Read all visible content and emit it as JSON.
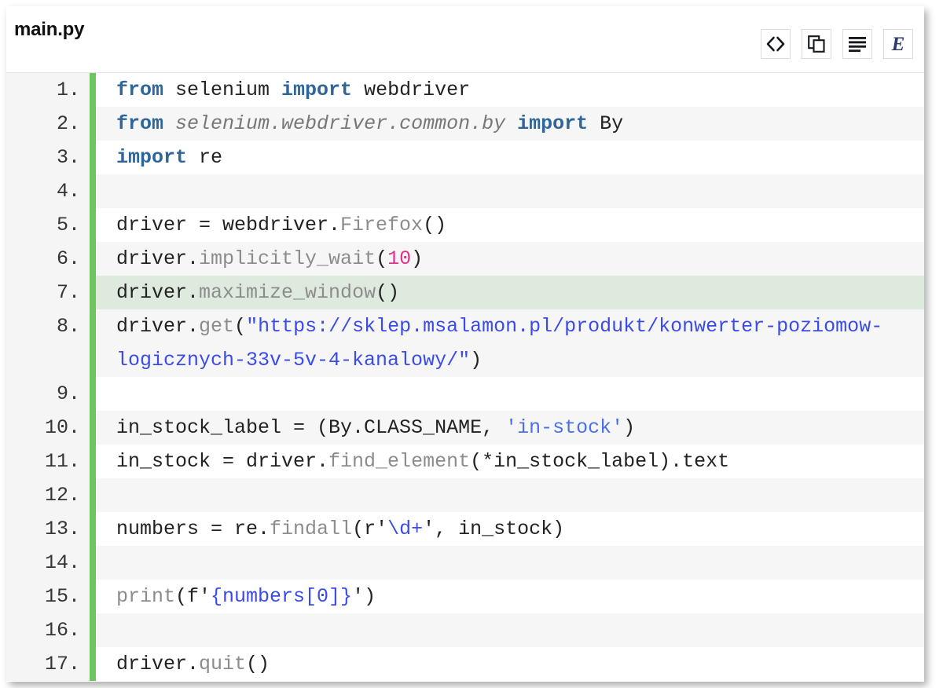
{
  "header": {
    "file_title": "main.py"
  },
  "toolbar": {
    "buttons": [
      {
        "name": "view-source-button",
        "icon": "code-brackets-icon",
        "label": "<>"
      },
      {
        "name": "copy-code-button",
        "icon": "copy-icon",
        "label": "Copy"
      },
      {
        "name": "toggle-raw-button",
        "icon": "list-lines-icon",
        "label": "Raw"
      },
      {
        "name": "enlighter-logo-button",
        "icon": "enlighter-e-icon",
        "label": "E"
      }
    ]
  },
  "editor": {
    "language": "python",
    "highlighted_line": 7,
    "gutter_accent_color": "#6ec45f",
    "highlight_row_color": "#dfeade",
    "lines": [
      {
        "number": "1.",
        "tokens": [
          {
            "t": "from",
            "c": "kw"
          },
          {
            "t": " selenium ",
            "c": "plain"
          },
          {
            "t": "import",
            "c": "kw"
          },
          {
            "t": " webdriver",
            "c": "plain"
          }
        ]
      },
      {
        "number": "2.",
        "tokens": [
          {
            "t": "from",
            "c": "kw"
          },
          {
            "t": " ",
            "c": "plain"
          },
          {
            "t": "selenium.webdriver.common.by",
            "c": "mod"
          },
          {
            "t": " ",
            "c": "plain"
          },
          {
            "t": "import",
            "c": "kw"
          },
          {
            "t": " By",
            "c": "plain"
          }
        ]
      },
      {
        "number": "3.",
        "tokens": [
          {
            "t": "import",
            "c": "kw"
          },
          {
            "t": " re",
            "c": "plain"
          }
        ]
      },
      {
        "number": "4.",
        "tokens": []
      },
      {
        "number": "5.",
        "tokens": [
          {
            "t": "driver = webdriver.",
            "c": "plain"
          },
          {
            "t": "Firefox",
            "c": "meth"
          },
          {
            "t": "()",
            "c": "plain"
          }
        ]
      },
      {
        "number": "6.",
        "tokens": [
          {
            "t": "driver.",
            "c": "plain"
          },
          {
            "t": "implicitly_wait",
            "c": "meth"
          },
          {
            "t": "(",
            "c": "plain"
          },
          {
            "t": "10",
            "c": "num"
          },
          {
            "t": ")",
            "c": "plain"
          }
        ]
      },
      {
        "number": "7.",
        "tokens": [
          {
            "t": "driver.",
            "c": "plain"
          },
          {
            "t": "maximize_window",
            "c": "meth"
          },
          {
            "t": "()",
            "c": "plain"
          }
        ]
      },
      {
        "number": "8.",
        "tokens": [
          {
            "t": "driver.",
            "c": "plain"
          },
          {
            "t": "get",
            "c": "meth"
          },
          {
            "t": "(",
            "c": "plain"
          },
          {
            "t": "\"https://sklep.msalamon.pl/produkt/konwerter-poziomow-logicznych-33v-5v-4-kanalowy/\"",
            "c": "str"
          },
          {
            "t": ")",
            "c": "plain"
          }
        ]
      },
      {
        "number": "9.",
        "tokens": []
      },
      {
        "number": "10.",
        "tokens": [
          {
            "t": "in_stock_label = (By.CLASS_NAME, ",
            "c": "plain"
          },
          {
            "t": "'in-stock'",
            "c": "str2"
          },
          {
            "t": ")",
            "c": "plain"
          }
        ]
      },
      {
        "number": "11.",
        "tokens": [
          {
            "t": "in_stock = driver.",
            "c": "plain"
          },
          {
            "t": "find_element",
            "c": "meth"
          },
          {
            "t": "(*in_stock_label).text",
            "c": "plain"
          }
        ]
      },
      {
        "number": "12.",
        "tokens": []
      },
      {
        "number": "13.",
        "tokens": [
          {
            "t": "numbers = re.",
            "c": "plain"
          },
          {
            "t": "findall",
            "c": "meth"
          },
          {
            "t": "(r'",
            "c": "plain"
          },
          {
            "t": "\\d+",
            "c": "str"
          },
          {
            "t": "', in_stock)",
            "c": "plain"
          }
        ]
      },
      {
        "number": "14.",
        "tokens": []
      },
      {
        "number": "15.",
        "tokens": [
          {
            "t": "print",
            "c": "meth"
          },
          {
            "t": "(f'",
            "c": "plain"
          },
          {
            "t": "{numbers[0]}",
            "c": "str"
          },
          {
            "t": "')",
            "c": "plain"
          }
        ]
      },
      {
        "number": "16.",
        "tokens": []
      },
      {
        "number": "17.",
        "tokens": [
          {
            "t": "driver.",
            "c": "plain"
          },
          {
            "t": "quit",
            "c": "meth"
          },
          {
            "t": "()",
            "c": "plain"
          }
        ]
      }
    ]
  }
}
